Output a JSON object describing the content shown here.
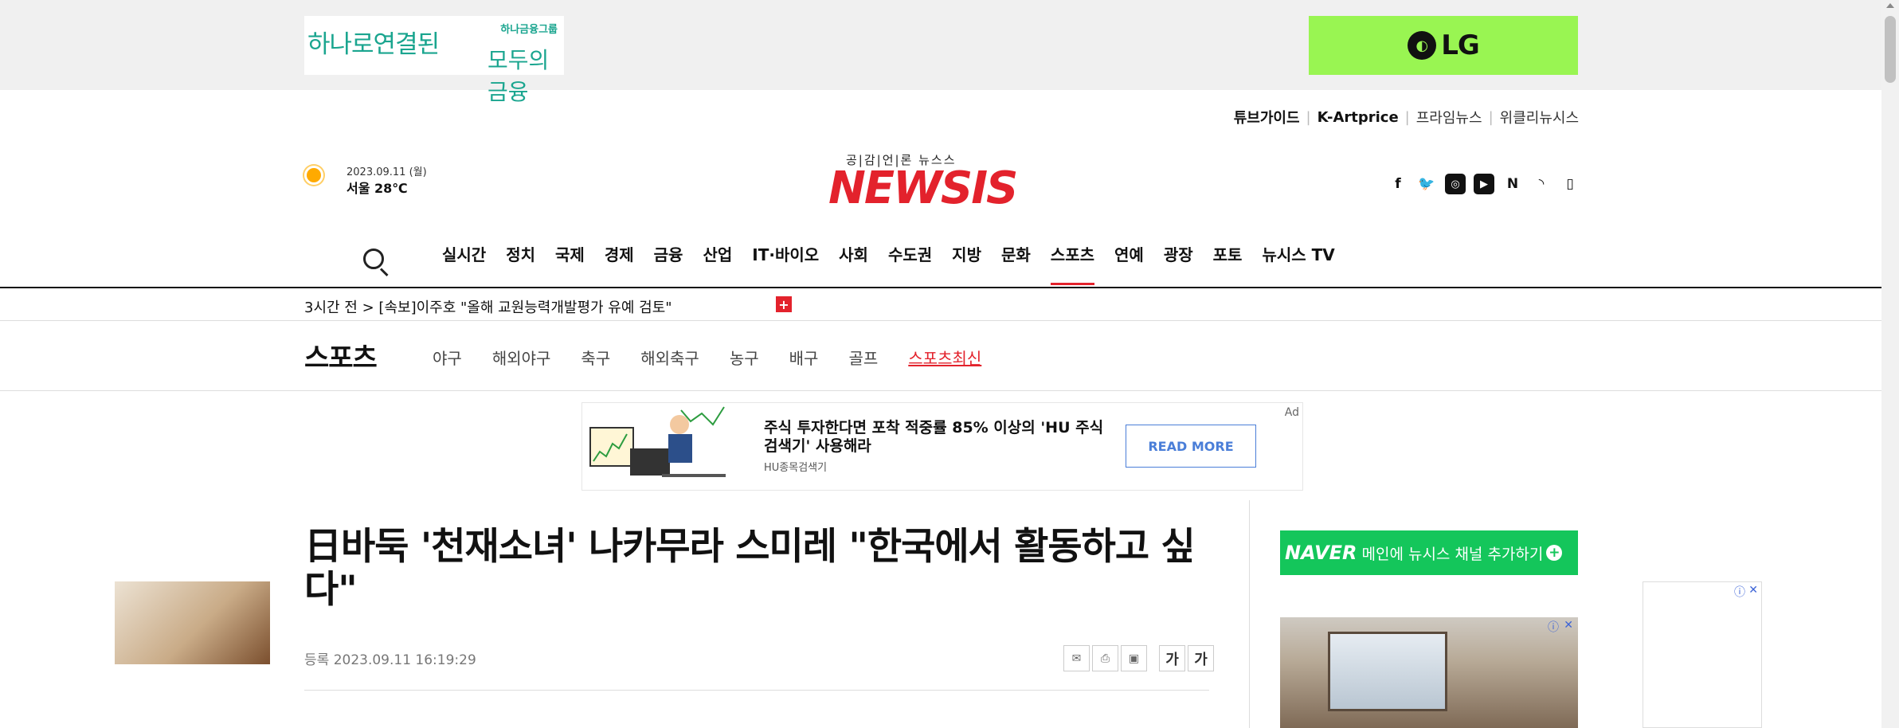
{
  "ads": {
    "hana": {
      "left": "하나로연결된",
      "group": "하나금융그룹",
      "right": "모두의 금융"
    },
    "lg": {
      "text": "LG"
    },
    "stock": {
      "title": "주식 투자한다면 포착 적중률 85% 이상의 'HU 주식 검색기' 사용해라",
      "source": "HU종목검색기",
      "button": "READ MORE",
      "ad_label": "Ad"
    },
    "naver": {
      "logo": "NAVER",
      "text": "메인에 뉴시스 채널 추가하기",
      "plus": "+"
    }
  },
  "header": {
    "ext_links": [
      "튜브가이드",
      "K-Artprice",
      "프라임뉴스",
      "위클리뉴시스"
    ],
    "weather": {
      "date": "2023.09.11 (월)",
      "temp": "서울 28℃"
    },
    "logo_tag": "공|감|언|론 뉴스스",
    "logo": "NEWSIS",
    "social_icons": [
      "facebook-icon",
      "twitter-icon",
      "instagram-icon",
      "youtube-icon",
      "naver-icon",
      "rss-icon",
      "mobile-icon"
    ]
  },
  "nav": {
    "items": [
      "실시간",
      "정치",
      "국제",
      "경제",
      "금융",
      "산업",
      "IT·바이오",
      "사회",
      "수도권",
      "지방",
      "문화",
      "스포츠",
      "연예",
      "광장",
      "포토",
      "뉴시스 TV"
    ],
    "active": "스포츠"
  },
  "ticker": {
    "time": "3시간 전",
    "arrow": ">",
    "text": "[속보]이주호 \"올해 교원능력개발평가 유예 검토\"",
    "plus": "+"
  },
  "section": {
    "title": "스포츠",
    "subnav": [
      "야구",
      "해외야구",
      "축구",
      "해외축구",
      "농구",
      "배구",
      "골프",
      "스포츠최신"
    ],
    "active": "스포츠최신"
  },
  "article": {
    "headline": "日바둑 '천재소녀' 나카무라 스미레 \"한국에서 활동하고 싶다\"",
    "date_label": "등록",
    "date": "2023.09.11 16:19:29",
    "tools": {
      "email": "✉",
      "print": "⎙",
      "pdf": "▣",
      "font_small": "가",
      "font_large": "가"
    }
  },
  "colors": {
    "brand_red": "#e3222c",
    "lg_green": "#99f552",
    "naver_green": "#14c65b",
    "hana_teal": "#1aa58f"
  }
}
